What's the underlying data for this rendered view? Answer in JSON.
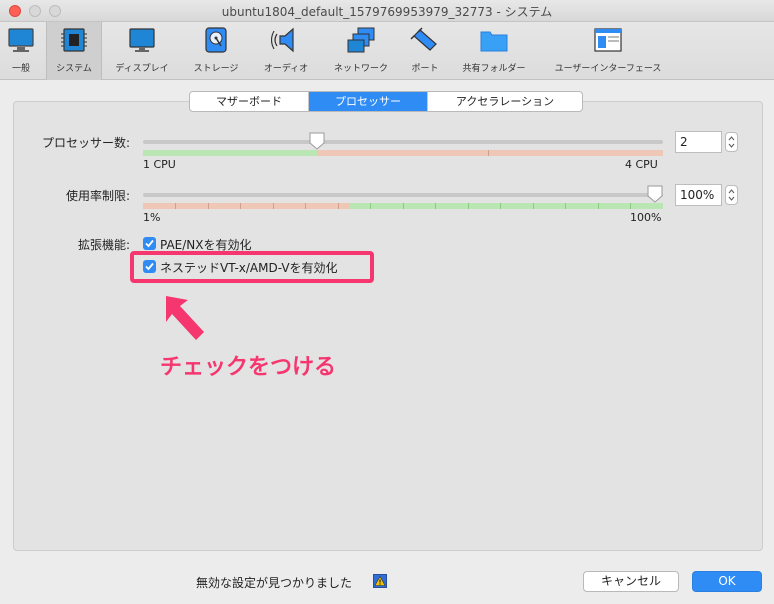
{
  "window": {
    "title": "ubuntu1804_default_1579769953979_32773 - システム"
  },
  "toolbar": {
    "items": [
      {
        "label": "一般",
        "icon": "monitor-icon"
      },
      {
        "label": "システム",
        "icon": "chip-icon"
      },
      {
        "label": "ディスプレイ",
        "icon": "display-icon"
      },
      {
        "label": "ストレージ",
        "icon": "disk-icon"
      },
      {
        "label": "オーディオ",
        "icon": "speaker-icon"
      },
      {
        "label": "ネットワーク",
        "icon": "network-icon"
      },
      {
        "label": "ポート",
        "icon": "plug-icon"
      },
      {
        "label": "共有フォルダー",
        "icon": "folder-icon"
      },
      {
        "label": "ユーザーインターフェース",
        "icon": "window-icon"
      }
    ],
    "selected": "システム"
  },
  "tabs": [
    {
      "label": "マザーボード",
      "active": false
    },
    {
      "label": "プロセッサー",
      "active": true
    },
    {
      "label": "アクセラレーション",
      "active": false
    }
  ],
  "processor": {
    "cpu_count_label": "プロセッサー数:",
    "cpu_count_value": "2",
    "cpu_count_min": "1 CPU",
    "cpu_count_max": "4 CPU",
    "cpu_count_level": 0.33,
    "cpu_cap_label": "使用率制限:",
    "cpu_cap_value": "100%",
    "cpu_cap_min": "1%",
    "cpu_cap_max": "100%",
    "cpu_cap_level": 1.0
  },
  "extended": {
    "label": "拡張機能:",
    "pae_label": "PAE/NXを有効化",
    "pae_checked": true,
    "nested_label": "ネステッドVT-x/AMD-Vを有効化",
    "nested_checked": true
  },
  "annotation": {
    "text": "チェックをつける",
    "color": "#f5366f"
  },
  "footer": {
    "status": "無効な設定が見つかりました",
    "cancel_label": "キャンセル",
    "ok_label": "OK"
  },
  "colors": {
    "accent": "#2f8cf5",
    "annotation": "#f5366f",
    "slider_ok": "#b9e6b2",
    "slider_warn": "#eec7b7"
  }
}
